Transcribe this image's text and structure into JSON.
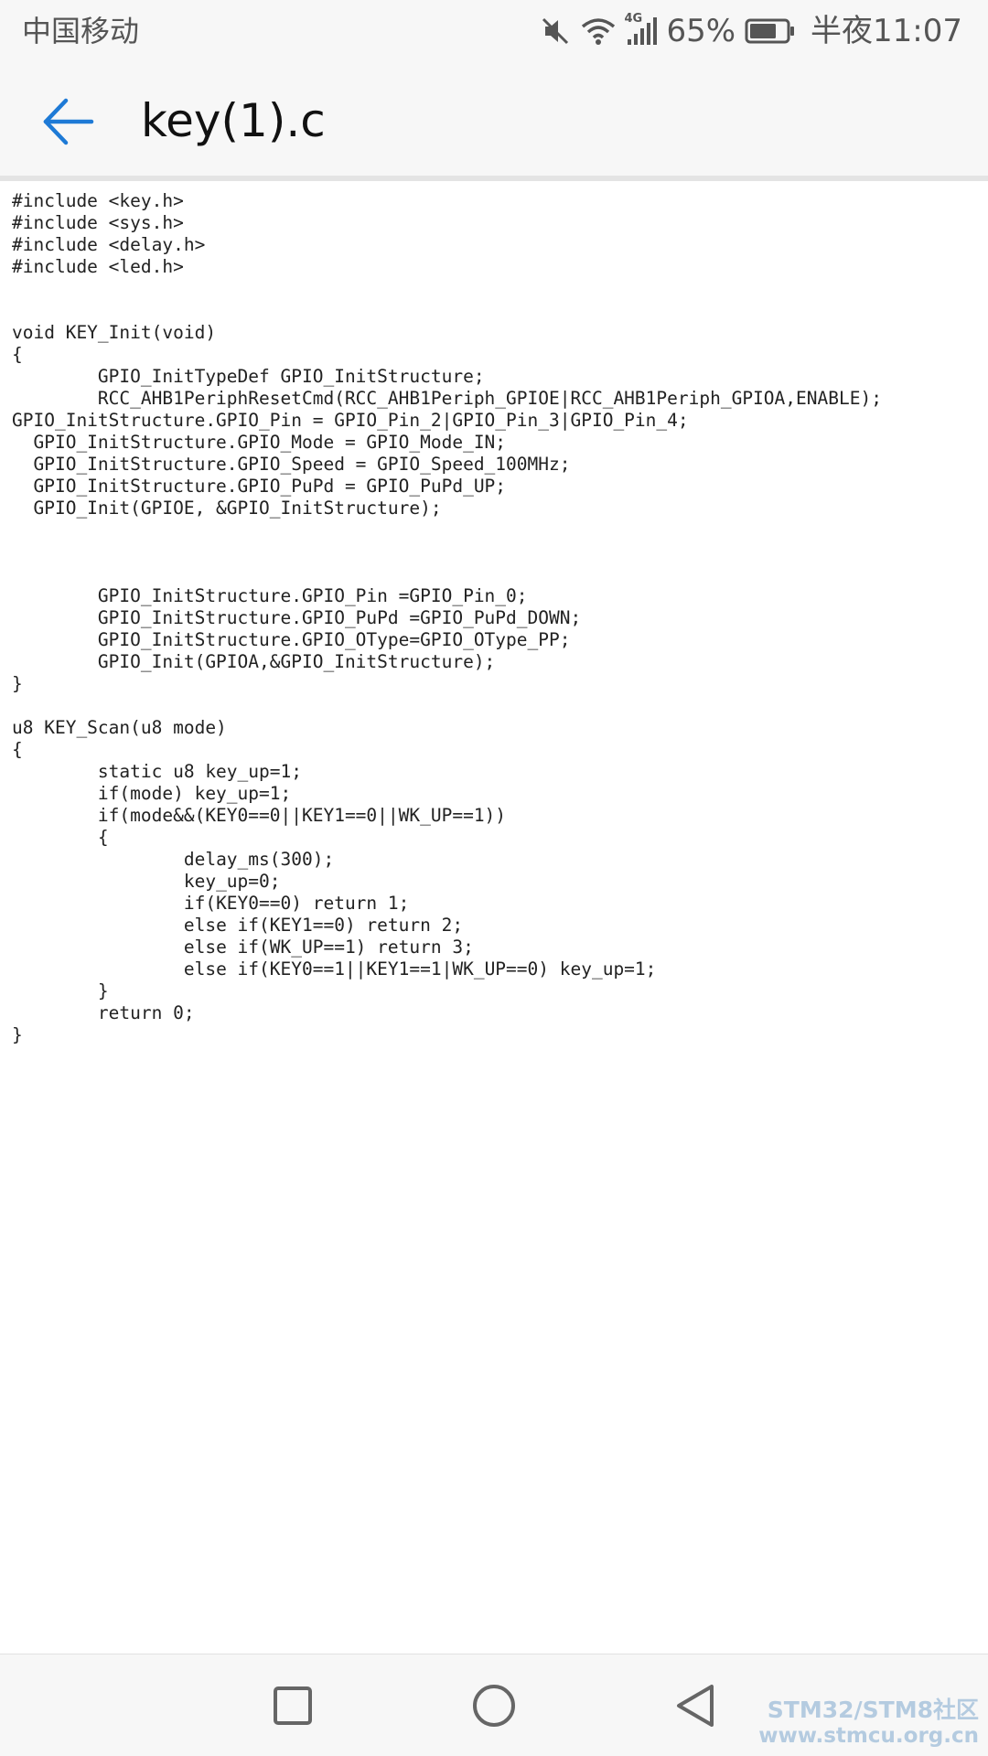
{
  "status_bar": {
    "carrier": "中国移动",
    "network_type": "4G",
    "battery": "65%",
    "time": "半夜11:07",
    "icons": [
      "mute-icon",
      "wifi-icon",
      "signal-icon",
      "battery-icon"
    ]
  },
  "app_bar": {
    "back_icon": "back-arrow-icon",
    "title": "key(1).c"
  },
  "code": {
    "lines": [
      "#include <key.h>",
      "#include <sys.h>",
      "#include <delay.h>",
      "#include <led.h>",
      "",
      "",
      "void KEY_Init(void)",
      "{",
      "\tGPIO_InitTypeDef GPIO_InitStructure;",
      "\tRCC_AHB1PeriphResetCmd(RCC_AHB1Periph_GPIOE|RCC_AHB1Periph_GPIOA,ENABLE);",
      "GPIO_InitStructure.GPIO_Pin = GPIO_Pin_2|GPIO_Pin_3|GPIO_Pin_4;",
      "  GPIO_InitStructure.GPIO_Mode = GPIO_Mode_IN;",
      "  GPIO_InitStructure.GPIO_Speed = GPIO_Speed_100MHz;",
      "  GPIO_InitStructure.GPIO_PuPd = GPIO_PuPd_UP;",
      "  GPIO_Init(GPIOE, &GPIO_InitStructure);",
      "",
      "",
      "",
      "\tGPIO_InitStructure.GPIO_Pin =GPIO_Pin_0;",
      "\tGPIO_InitStructure.GPIO_PuPd =GPIO_PuPd_DOWN;",
      "\tGPIO_InitStructure.GPIO_OType=GPIO_OType_PP;",
      "\tGPIO_Init(GPIOA,&GPIO_InitStructure);",
      "}",
      "",
      "u8 KEY_Scan(u8 mode)",
      "{",
      "\tstatic u8 key_up=1;",
      "\tif(mode) key_up=1;",
      "\tif(mode&&(KEY0==0||KEY1==0||WK_UP==1))",
      "\t{",
      "\t\tdelay_ms(300);",
      "\t\tkey_up=0;",
      "\t\tif(KEY0==0) return 1;",
      "\t\telse if(KEY1==0) return 2;",
      "\t\telse if(WK_UP==1) return 3;",
      "\t\telse if(KEY0==1||KEY1==1|WK_UP==0) key_up=1;",
      "\t}",
      "\treturn 0;",
      "}"
    ]
  },
  "nav_bar": {
    "recents_icon": "square-recents-icon",
    "home_icon": "circle-home-icon",
    "back_icon": "triangle-back-icon"
  },
  "watermark": {
    "line1": "STM32/STM8社区",
    "line2": "www.stmcu.org.cn"
  },
  "colors": {
    "accent": "#1e7ad6",
    "bar_background": "#f7f7f7",
    "code_text": "#222222",
    "watermark": "#a9c4dc"
  }
}
